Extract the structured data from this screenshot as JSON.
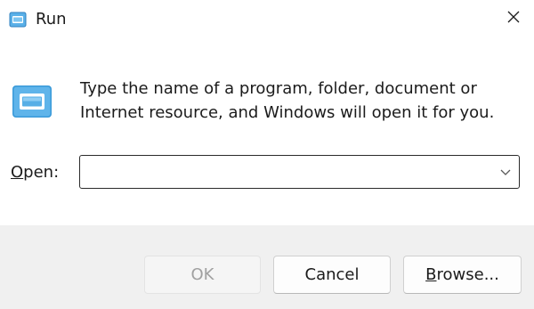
{
  "window": {
    "title": "Run",
    "title_icon": "run-icon",
    "close_icon": "close-icon"
  },
  "body": {
    "app_icon": "run-icon",
    "description_line1": "Type the name of a program, folder, document or",
    "description_line2": "Internet resource, and Windows will open it for you.",
    "open_label_mnemonic": "O",
    "open_label_rest": "pen:",
    "open_input_value": "",
    "dropdown_icon": "chevron-down-icon"
  },
  "buttons": {
    "ok_label": "OK",
    "ok_enabled": false,
    "cancel_label": "Cancel",
    "browse_label_mnemonic": "B",
    "browse_label_rest": "rowse..."
  },
  "colors": {
    "accent": "#0067c0",
    "footer_bg": "#f0f0f0",
    "disabled_text": "#a0a0a0"
  }
}
